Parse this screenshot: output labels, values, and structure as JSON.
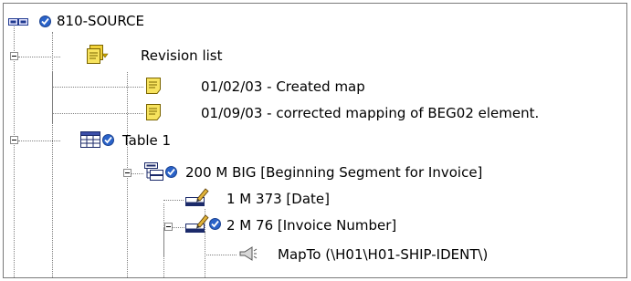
{
  "tree": {
    "root": {
      "label": "810-SOURCE",
      "icon": "link-chain-icon"
    },
    "revision_list": {
      "label": "Revision list",
      "items": [
        {
          "label": "01/02/03 - Created map",
          "icon": "note-icon"
        },
        {
          "label": "01/09/03 - corrected mapping of BEG02 element.",
          "icon": "note-icon"
        }
      ]
    },
    "table1": {
      "label": "Table 1",
      "icon": "table-icon"
    },
    "segment": {
      "label": "200 M BIG [Beginning Segment for Invoice]",
      "icon": "segment-icon"
    },
    "element_date": {
      "label": "1 M 373 [Date]",
      "icon": "element-edit-icon"
    },
    "element_invoice": {
      "label": "2 M 76 [Invoice Number]",
      "icon": "element-edit-icon"
    },
    "mapto": {
      "label": "MapTo (\\H01\\H01-SHIP-IDENT\\)",
      "icon": "megaphone-icon"
    }
  },
  "colors": {
    "check": "#2a63c9",
    "note": "#f2d23a",
    "tree_line": "#808080"
  }
}
